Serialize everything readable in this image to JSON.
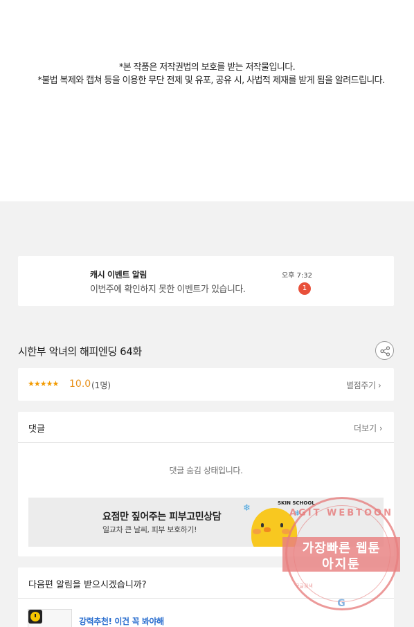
{
  "notice": {
    "line1": "*본 작품은 저작권법의 보호를 받는 저작물입니다.",
    "line2": "*불법 복제와 캡쳐 등을 이용한 무단 전제 및 유포, 공유 시, 사법적 제재를 받게 됨을 알려드립니다."
  },
  "alarm": {
    "title": "캐시 이벤트 알림",
    "message": "이번주에 확인하지 못한 이벤트가 있습니다.",
    "time": "오후 7:32",
    "badge": "1"
  },
  "episode": {
    "title": "시한부 악녀의 해피엔딩 64화",
    "share_icon": "share-icon"
  },
  "rating": {
    "stars": "★★★★★",
    "score": "10.0",
    "count": "(1명)",
    "rate_label": "별점주기 ›"
  },
  "comments": {
    "title": "댓글",
    "more_label": "더보기 ›",
    "hidden_message": "댓글 숨김 상태입니다."
  },
  "ad": {
    "title": "요점만 짚어주는 피부고민상담",
    "subtitle": "일교차 큰 날씨, 피부 보호하기!",
    "brand": "SKIN SCHOOL"
  },
  "next_alert": {
    "title": "다음편 알림을 받으시겠습니까?",
    "promo": "강력추천! 이건 꼭 봐야해"
  },
  "watermark": {
    "arc_text": "AGIT WEBTOON",
    "line1": "가장빠른 웹툰",
    "line2": "아지툰",
    "small": "구글검색",
    "bottom": "G"
  },
  "colors": {
    "accent_star": "#f29a00",
    "badge": "#e8503a",
    "link": "#2a6ecf",
    "page_bg": "#f2f2f2"
  }
}
